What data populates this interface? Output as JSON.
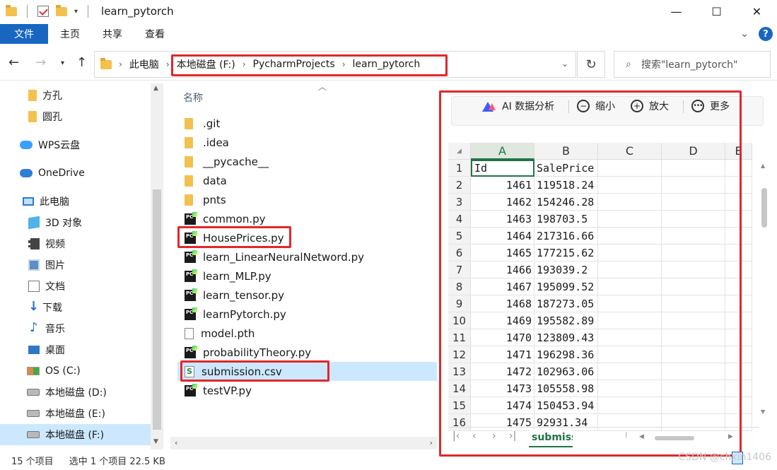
{
  "window": {
    "title": "learn_pytorch",
    "controls": {
      "minimize": "—",
      "maximize": "☐",
      "close": "✕"
    }
  },
  "ribbon": {
    "file_tab": "文件",
    "tabs": [
      "主页",
      "共享",
      "查看"
    ]
  },
  "address": {
    "segments": [
      "此电脑",
      "本地磁盘 (F:)",
      "PycharmProjects",
      "learn_pytorch"
    ],
    "search_placeholder": "搜索\"learn_pytorch\""
  },
  "sidebar": {
    "items": [
      {
        "label": "方孔",
        "icon": "folder-icon"
      },
      {
        "label": "圆孔",
        "icon": "folder-icon"
      },
      {
        "label": "WPS云盘",
        "icon": "wps-cloud-icon"
      },
      {
        "label": "OneDrive",
        "icon": "onedrive-cloud-icon"
      },
      {
        "label": "此电脑",
        "icon": "this-pc-icon"
      },
      {
        "label": "3D 对象",
        "icon": "3d-objects-icon"
      },
      {
        "label": "视频",
        "icon": "video-icon"
      },
      {
        "label": "图片",
        "icon": "pictures-icon"
      },
      {
        "label": "文档",
        "icon": "documents-icon"
      },
      {
        "label": "下载",
        "icon": "downloads-icon"
      },
      {
        "label": "音乐",
        "icon": "music-icon"
      },
      {
        "label": "桌面",
        "icon": "desktop-icon"
      },
      {
        "label": "OS (C:)",
        "icon": "os-drive-icon"
      },
      {
        "label": "本地磁盘 (D:)",
        "icon": "drive-icon"
      },
      {
        "label": "本地磁盘 (E:)",
        "icon": "drive-icon"
      },
      {
        "label": "本地磁盘 (F:)",
        "icon": "drive-icon"
      }
    ]
  },
  "filelist": {
    "column_name": "名称",
    "files": [
      {
        "name": ".git",
        "type": "folder"
      },
      {
        "name": ".idea",
        "type": "folder"
      },
      {
        "name": "__pycache__",
        "type": "folder"
      },
      {
        "name": "data",
        "type": "folder"
      },
      {
        "name": "pnts",
        "type": "folder"
      },
      {
        "name": "common.py",
        "type": "py"
      },
      {
        "name": "HousePrices.py",
        "type": "py"
      },
      {
        "name": "learn_LinearNeuralNetword.py",
        "type": "py"
      },
      {
        "name": "learn_MLP.py",
        "type": "py"
      },
      {
        "name": "learn_tensor.py",
        "type": "py"
      },
      {
        "name": "learnPytorch.py",
        "type": "py"
      },
      {
        "name": "model.pth",
        "type": "file"
      },
      {
        "name": "probabilityTheory.py",
        "type": "py"
      },
      {
        "name": "submission.csv",
        "type": "csv"
      },
      {
        "name": "testVP.py",
        "type": "py"
      }
    ],
    "selected_index": 13
  },
  "preview": {
    "toolbar": {
      "ai": "AI 数据分析",
      "zoom_out": "缩小",
      "zoom_in": "放大",
      "more": "更多"
    },
    "columns": [
      "A",
      "B",
      "C",
      "D",
      "E"
    ],
    "rows": [
      {
        "n": "1",
        "a": "Id",
        "b": "SalePrice"
      },
      {
        "n": "2",
        "a": "1461",
        "b": "119518.24"
      },
      {
        "n": "3",
        "a": "1462",
        "b": "154246.28"
      },
      {
        "n": "4",
        "a": "1463",
        "b": "198703.5"
      },
      {
        "n": "5",
        "a": "1464",
        "b": "217316.66"
      },
      {
        "n": "6",
        "a": "1465",
        "b": "177215.62"
      },
      {
        "n": "7",
        "a": "1466",
        "b": "193039.2"
      },
      {
        "n": "8",
        "a": "1467",
        "b": "195099.52"
      },
      {
        "n": "9",
        "a": "1468",
        "b": "187273.05"
      },
      {
        "n": "10",
        "a": "1469",
        "b": "195582.89"
      },
      {
        "n": "11",
        "a": "1470",
        "b": "123809.43"
      },
      {
        "n": "12",
        "a": "1471",
        "b": "196298.36"
      },
      {
        "n": "13",
        "a": "1472",
        "b": "102963.06"
      },
      {
        "n": "14",
        "a": "1473",
        "b": "105558.98"
      },
      {
        "n": "15",
        "a": "1474",
        "b": "150453.94"
      },
      {
        "n": "16",
        "a": "1475",
        "b": "92931.34"
      }
    ],
    "sheet_tab": "submiss"
  },
  "status": {
    "item_count": "15 个项目",
    "selection": "选中 1 个项目  22.5 KB",
    "watermark": "CSDN @chxin1406"
  },
  "colors": {
    "accent": "#1966c2",
    "highlight": "#e3262b",
    "selection": "#cce8ff",
    "sheet_green": "#217346"
  }
}
